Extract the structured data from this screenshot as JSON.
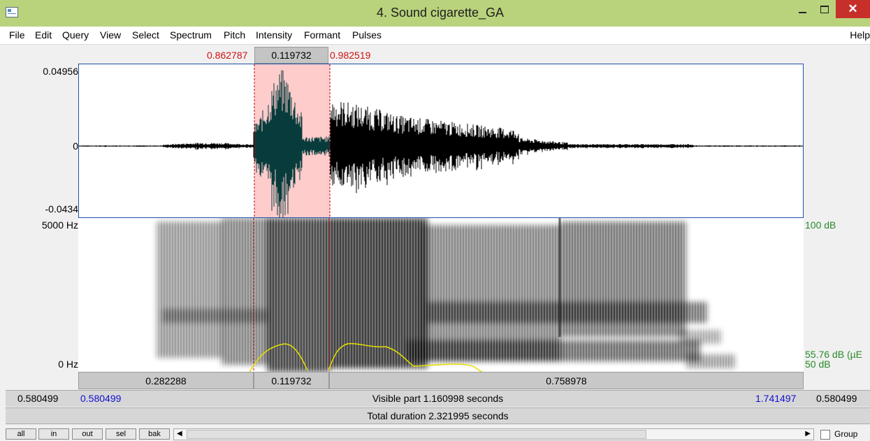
{
  "window": {
    "title": "4. Sound cigarette_GA",
    "close_glyph": "✕"
  },
  "menu": {
    "items": [
      "File",
      "Edit",
      "Query",
      "View",
      "Select",
      "Spectrum",
      "Pitch",
      "Intensity",
      "Formant",
      "Pulses"
    ],
    "help": "Help"
  },
  "selection": {
    "start": "0.862787",
    "duration": "0.119732",
    "end": "0.982519"
  },
  "waveform": {
    "ymax": "0.04956",
    "zero": "0",
    "ymin": "-0.0434"
  },
  "spectrogram": {
    "fmax": "5000 Hz",
    "fmin": "0 Hz",
    "db_max": "100 dB",
    "db_cursor": "55.76 dB (µE",
    "db_min": "50 dB"
  },
  "segments": {
    "left": "0.282288",
    "selected": "0.119732",
    "right": "0.758978"
  },
  "visible": {
    "left_outer": "0.580499",
    "left_inner": "0.580499",
    "label": "Visible part 1.160998 seconds",
    "right_inner": "1.741497",
    "right_outer": "0.580499"
  },
  "total": {
    "label": "Total duration 2.321995 seconds"
  },
  "nav": {
    "all": "all",
    "in": "in",
    "out": "out",
    "sel": "sel",
    "bak": "bak",
    "group": "Group",
    "left_arrow": "◀",
    "right_arrow": "▶"
  },
  "colors": {
    "titlebar": "#b9d27c",
    "selection": "#ffcccc",
    "selection_border": "#c00000",
    "pitch": "#e6e000",
    "waveform": "#000000",
    "waveform_selected": "#083c3c"
  }
}
